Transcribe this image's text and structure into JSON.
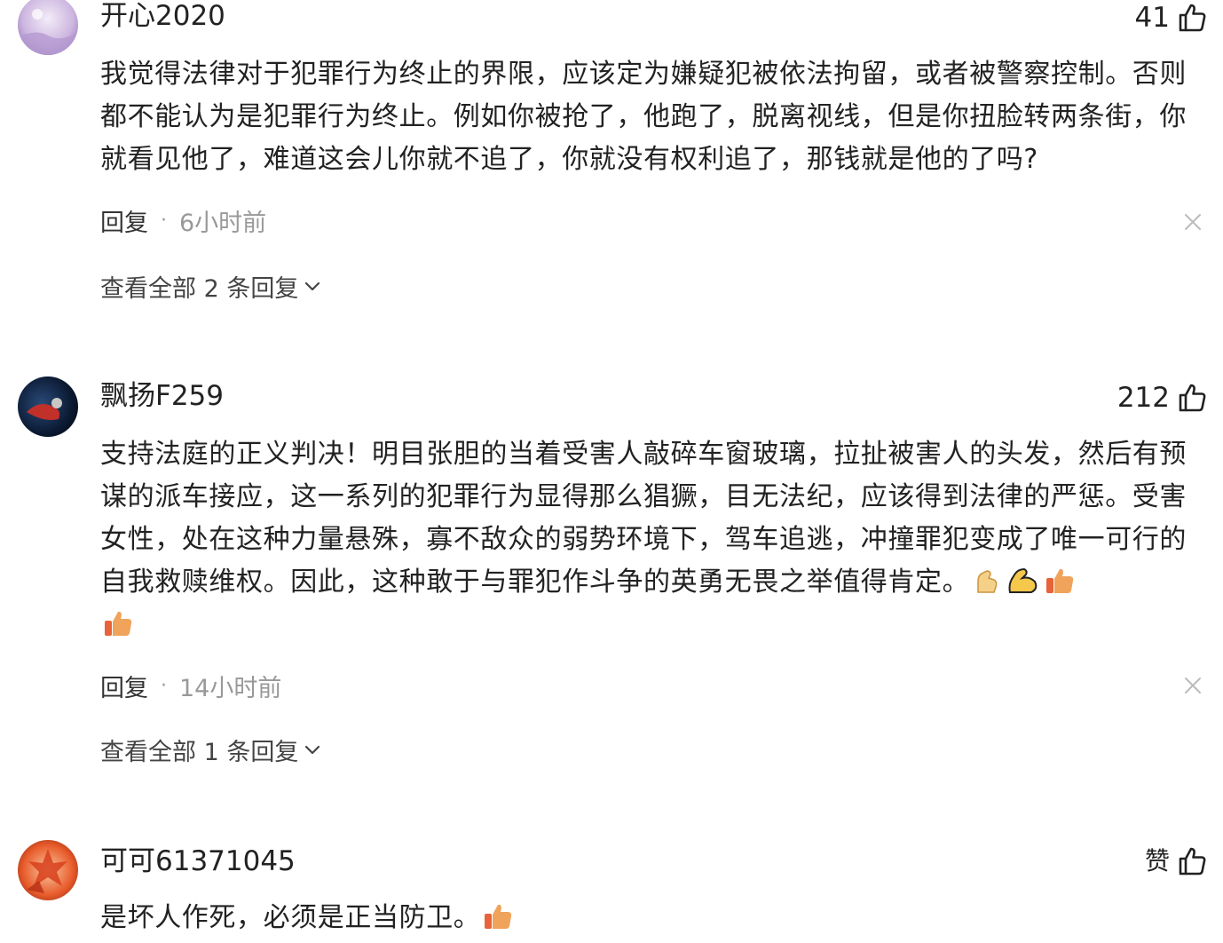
{
  "comments": [
    {
      "username": "开心2020",
      "likes": "41",
      "text": "我觉得法律对于犯罪行为终止的界限，应该定为嫌疑犯被依法拘留，或者被警察控制。否则都不能认为是犯罪行为终止。例如你被抢了，他跑了，脱离视线，但是你扭脸转两条街，你就看见他了，难道这会儿你就不追了，你就没有权利追了，那钱就是他的了吗?",
      "reply_label": "回复",
      "separator": "·",
      "time": "6小时前",
      "view_replies": "查看全部 2 条回复",
      "avatar_colors": [
        "#d9c4e8",
        "#8a6bb3"
      ]
    },
    {
      "username": "飘扬F259",
      "likes": "212",
      "text": "支持法庭的正义判决！明目张胆的当着受害人敲碎车窗玻璃，拉扯被害人的头发，然后有预谋的派车接应，这一系列的犯罪行为显得那么猖獗，目无法纪，应该得到法律的严惩。受害女性，处在这种力量悬殊，寡不敌众的弱势环境下，驾车追逃，冲撞罪犯变成了唯一可行的自我救赎维权。因此，这种敢于与罪犯作斗争的英勇无畏之举值得肯定。",
      "emojis": [
        "flexed-arm-emoji",
        "muscle-emoji",
        "thumbs-up-emoji",
        "thumbs-up-emoji"
      ],
      "reply_label": "回复",
      "separator": "·",
      "time": "14小时前",
      "view_replies": "查看全部 1 条回复",
      "avatar_colors": [
        "#0b1a33",
        "#c2302a"
      ]
    },
    {
      "username": "可可61371045",
      "likes": "赞",
      "text": "是坏人作死，必须是正当防卫。",
      "emojis": [
        "thumbs-up-emoji"
      ],
      "avatar_colors": [
        "#e85a2a",
        "#f3a66b"
      ]
    }
  ],
  "colors": {
    "text_primary": "#222222",
    "text_secondary": "#999999",
    "emoji_yellow": "#f5c74a",
    "emoji_orange": "#f0a35a"
  }
}
